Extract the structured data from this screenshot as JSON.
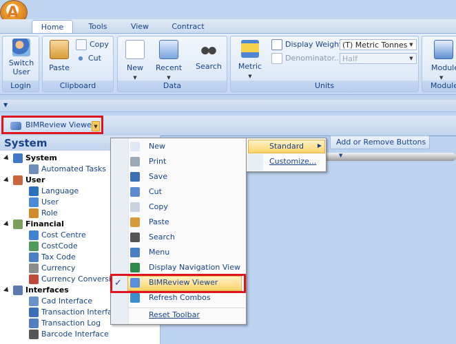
{
  "tabs": [
    "Home",
    "Tools",
    "View",
    "Contract"
  ],
  "ribbon": {
    "login": {
      "label": "Login",
      "switch_user": "Switch User"
    },
    "clipboard": {
      "label": "Clipboard",
      "paste": "Paste",
      "copy": "Copy",
      "cut": "Cut"
    },
    "data": {
      "label": "Data",
      "new": "New",
      "recent": "Recent",
      "search": "Search"
    },
    "units": {
      "label": "Units",
      "metric": "Metric",
      "display_weight_label": "Display Weight",
      "display_weight_value": "(T) Metric Tonnes",
      "denominator_label": "Denominator...",
      "denominator_value": "Half"
    },
    "modules": {
      "label": "Module",
      "button": "Module"
    }
  },
  "toolbar": {
    "bim_viewer": "BIMReview Viewer"
  },
  "panel": {
    "title": "System",
    "tree": [
      {
        "label": "System",
        "cat": true
      },
      {
        "label": "Automated Tasks"
      },
      {
        "label": "User",
        "cat": true
      },
      {
        "label": "Language"
      },
      {
        "label": "User"
      },
      {
        "label": "Role"
      },
      {
        "label": "Financial",
        "cat": true
      },
      {
        "label": "Cost Centre"
      },
      {
        "label": "CostCode"
      },
      {
        "label": "Tax Code"
      },
      {
        "label": "Currency"
      },
      {
        "label": "Currency Conversio"
      },
      {
        "label": "Interfaces",
        "cat": true
      },
      {
        "label": "Cad Interface"
      },
      {
        "label": "Transaction Interfac"
      },
      {
        "label": "Transaction Log"
      },
      {
        "label": "Barcode Interface"
      }
    ]
  },
  "menu": {
    "items": [
      "New",
      "Print",
      "Save",
      "Cut",
      "Copy",
      "Paste",
      "Search",
      "Menu",
      "Display Navigation View",
      "BIMReview Viewer",
      "Refresh Combos",
      "Reset Toolbar"
    ],
    "checked_index": 9
  },
  "submenu": {
    "standard": "Standard",
    "customize": "Customize..."
  },
  "add_remove": "Add or Remove Buttons"
}
